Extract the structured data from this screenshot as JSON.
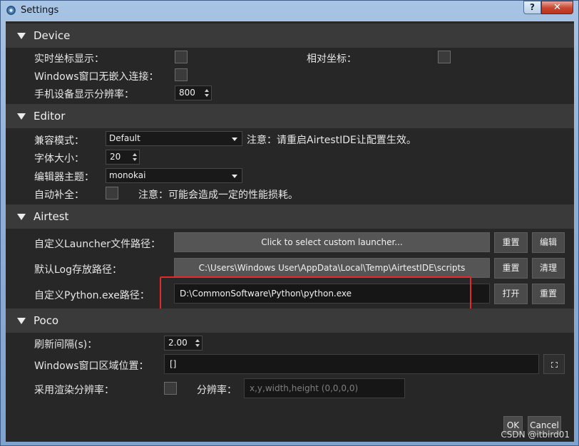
{
  "window": {
    "title": "Settings",
    "help_label": "?",
    "close_label": "✕"
  },
  "device": {
    "header": "Device",
    "realtime_coords_label": "实时坐标显示：",
    "relative_coords_label": "相对坐标：",
    "windows_no_embed_label": "Windows窗口无嵌入连接：",
    "phone_resolution_label": "手机设备显示分辨率：",
    "phone_resolution_value": "800"
  },
  "editor": {
    "header": "Editor",
    "compat_mode_label": "兼容模式：",
    "compat_mode_value": "Default",
    "compat_mode_note": "注意：请重启AirtestIDE让配置生效。",
    "font_size_label": "字体大小：",
    "font_size_value": "20",
    "theme_label": "编辑器主题：",
    "theme_value": "monokai",
    "autocomplete_label": "自动补全：",
    "autocomplete_note": "注意：可能会造成一定的性能损耗。"
  },
  "airtest": {
    "header": "Airtest",
    "launcher_label": "自定义Launcher文件路径：",
    "launcher_value": "Click to select custom launcher...",
    "launcher_reset": "重置",
    "launcher_edit": "编辑",
    "log_label": "默认Log存放路径：",
    "log_value": "C:\\Users\\Windows User\\AppData\\Local\\Temp\\AirtestIDE\\scripts",
    "log_reset": "重置",
    "log_clear": "清理",
    "python_label": "自定义Python.exe路径：",
    "python_value": "D:\\CommonSoftware\\Python\\python.exe",
    "python_open": "打开",
    "python_reset": "重置"
  },
  "poco": {
    "header": "Poco",
    "refresh_label": "刷新间隔(s)：",
    "refresh_value": "2.00",
    "win_region_label": "Windows窗口区域位置：",
    "win_region_value": "[]",
    "render_res_label": "采用渲染分辨率：",
    "resolution_label": "分辨率：",
    "resolution_placeholder": "x,y,width,height (0,0,0,0)"
  },
  "footer": {
    "ok_label": "OK",
    "cancel_label": "Cancel"
  },
  "watermark": "CSDN @itbird01",
  "colors": {
    "highlight": "#e6282b",
    "panel_bg": "#272727",
    "header_bg": "#3a3a3a"
  }
}
